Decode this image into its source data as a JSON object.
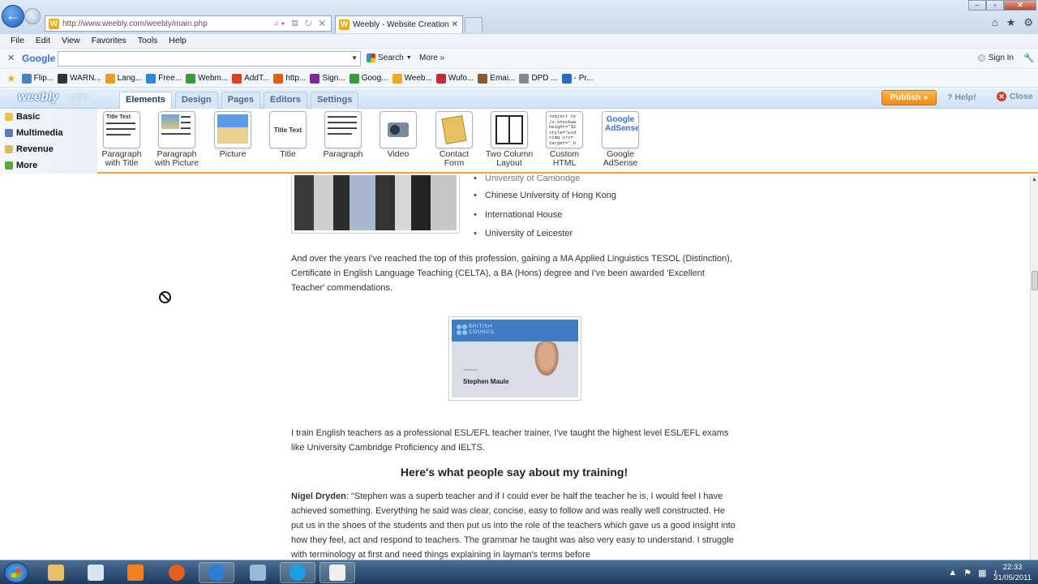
{
  "browser": {
    "address_url": "http://www.weebly.com/weebly/main.php",
    "tab_title": "Weebly - Website Creation ...",
    "menu": [
      "File",
      "Edit",
      "View",
      "Favorites",
      "Tools",
      "Help"
    ],
    "google_toolbar": {
      "logo": "Google",
      "search_label": "Search",
      "more_label": "More »",
      "signin_label": "Sign In"
    },
    "favorites": [
      {
        "label": "Flip...",
        "color": "#4a7fc0"
      },
      {
        "label": "WARN...",
        "color": "#333333"
      },
      {
        "label": "Lang...",
        "color": "#e0a020"
      },
      {
        "label": "Free...",
        "color": "#2a8ad8"
      },
      {
        "label": "Webm...",
        "color": "#3a9a3a"
      },
      {
        "label": "AddT...",
        "color": "#e04020"
      },
      {
        "label": "http...",
        "color": "#e06010"
      },
      {
        "label": "Sign...",
        "color": "#7a2a9a"
      },
      {
        "label": "Goog...",
        "color": "#3a9a3a"
      },
      {
        "label": "Weeb...",
        "color": "#f1a81c"
      },
      {
        "label": "Wufo...",
        "color": "#c03030"
      },
      {
        "label": "Emai...",
        "color": "#8a5a2a"
      },
      {
        "label": "DPD ...",
        "color": "#888888"
      },
      {
        "label": "- Pr...",
        "color": "#2a6ac0"
      }
    ]
  },
  "weebly": {
    "logo": "weebly",
    "logo_sub": "editor",
    "tabs": [
      "Elements",
      "Design",
      "Pages",
      "Editors",
      "Settings"
    ],
    "publish_label": "Publish »",
    "help_label": "Help!",
    "close_label": "Close",
    "side_menu": [
      {
        "label": "Basic",
        "color": "#e8c050"
      },
      {
        "label": "Multimedia",
        "color": "#5a7ab0"
      },
      {
        "label": "Revenue",
        "color": "#d8b860"
      },
      {
        "label": "More",
        "color": "#5aaa3a"
      }
    ],
    "elements": [
      {
        "label_1": "Paragraph",
        "label_2": "with Title",
        "thumb_text": "Title Text"
      },
      {
        "label_1": "Paragraph",
        "label_2": "with Picture",
        "thumb_text": ""
      },
      {
        "label_1": "Picture",
        "label_2": "",
        "thumb_text": ""
      },
      {
        "label_1": "Title",
        "label_2": "",
        "thumb_text": "Title Text"
      },
      {
        "label_1": "Paragraph",
        "label_2": "",
        "thumb_text": ""
      },
      {
        "label_1": "Video",
        "label_2": "",
        "thumb_text": ""
      },
      {
        "label_1": "Contact",
        "label_2": "Form",
        "thumb_text": ""
      },
      {
        "label_1": "Two Column",
        "label_2": "Layout",
        "thumb_text": ""
      },
      {
        "label_1": "Custom",
        "label_2": "HTML",
        "thumb_text": "<object ty /x-shockwa height=\"32 style=\"wid <img src= target=\"_b"
      },
      {
        "label_1": "Google",
        "label_2": "AdSense",
        "thumb_text": "Google AdSense"
      }
    ]
  },
  "page": {
    "bullets": [
      "University of Cambridge",
      "Chinese University of Hong Kong",
      "International House",
      "University of Leicester"
    ],
    "para1": "And over the years I've reached the top of this profession, gaining a MA Applied Linguistics TESOL (Distinction), Certificate in English Language Teaching (CELTA), a BA (Hons) degree and I've been awarded 'Excellent Teacher' commendations.",
    "badge_org": "BRITISH COUNCIL",
    "badge_name": "Stephen Maule",
    "para2": "I train English teachers as a professional ESL/EFL teacher trainer, I've taught the highest level ESL/EFL exams like University Cambridge Proficiency and IELTS.",
    "testimonials_title": "Here's what people say about my training!",
    "testimonial_author": "Nigel Dryden",
    "testimonial_text": ": \"Stephen was a superb teacher and if I could ever be half the teacher he is, I would feel I have achieved something. Everything he said was clear, concise, easy to follow and was really well constructed. He put us in the shoes of the students and then put us into the role of the teachers which gave us a good insight into how they feel, act and respond to teachers. The grammar he taught was also very easy to understand. I struggle with terminology at first and need things explaining in layman's terms before"
  },
  "taskbar": {
    "time": "22:33",
    "date": "31/05/2011",
    "apps": [
      {
        "name": "explorer",
        "color": "#e8c060"
      },
      {
        "name": "notepad",
        "color": "#d8e4f0"
      },
      {
        "name": "media-player",
        "color": "#f08020"
      },
      {
        "name": "firefox",
        "color": "#e06020"
      },
      {
        "name": "internet-explorer",
        "color": "#2a80d8"
      },
      {
        "name": "folder",
        "color": "#9ab8d8"
      },
      {
        "name": "skype",
        "color": "#1aa0e8"
      },
      {
        "name": "video-app",
        "color": "#eeeeee"
      }
    ]
  }
}
